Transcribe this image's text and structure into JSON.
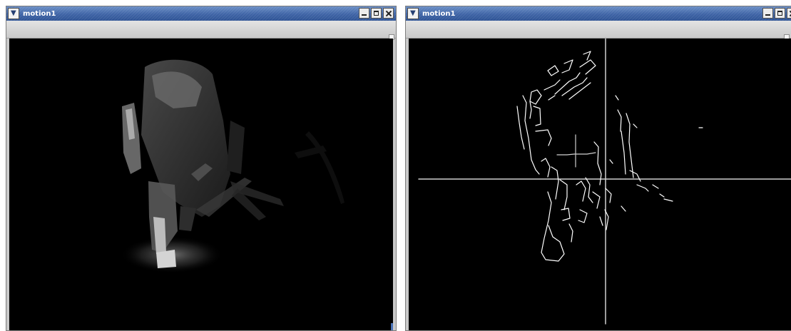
{
  "windows": [
    {
      "title": "motion1",
      "view": "grayscale-motion-frame"
    },
    {
      "title": "motion1",
      "view": "edge-detection-frame"
    }
  ],
  "icons": {
    "menu": "chevron-down-icon",
    "minimize": "minimize-icon",
    "maximize": "maximize-icon",
    "close": "close-icon"
  },
  "colors": {
    "titlebar": "#3f64a6",
    "canvas": "#000000",
    "edges": "#ffffff"
  }
}
